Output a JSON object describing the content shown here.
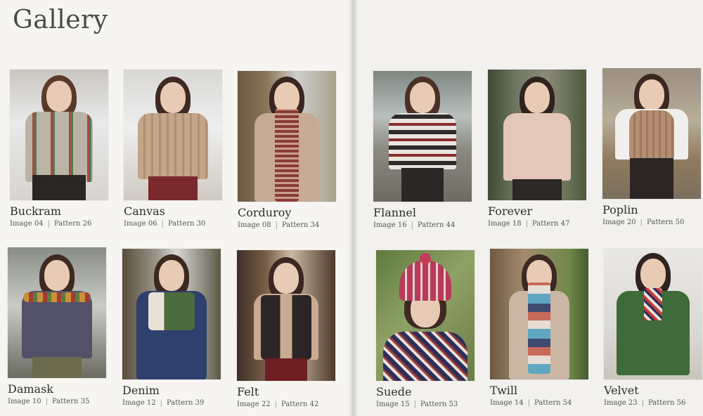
{
  "gallery": {
    "title": "Gallery",
    "items": [
      {
        "name": "Buckram",
        "image": "Image 04",
        "pattern": "Pattern 26"
      },
      {
        "name": "Canvas",
        "image": "Image 06",
        "pattern": "Pattern 30"
      },
      {
        "name": "Corduroy",
        "image": "Image 08",
        "pattern": "Pattern 34"
      },
      {
        "name": "Flannel",
        "image": "Image 16",
        "pattern": "Pattern 44"
      },
      {
        "name": "Forever",
        "image": "Image 18",
        "pattern": "Pattern 47"
      },
      {
        "name": "Poplin",
        "image": "Image 20",
        "pattern": "Pattern 50"
      },
      {
        "name": "Damask",
        "image": "Image 10",
        "pattern": "Pattern 35"
      },
      {
        "name": "Denim",
        "image": "Image 12",
        "pattern": "Pattern 39"
      },
      {
        "name": "Felt",
        "image": "Image 22",
        "pattern": "Pattern 42"
      },
      {
        "name": "Suede",
        "image": "Image 15",
        "pattern": "Pattern 53"
      },
      {
        "name": "Twill",
        "image": "Image 14",
        "pattern": "Pattern 54"
      },
      {
        "name": "Velvet",
        "image": "Image 23",
        "pattern": "Pattern 56"
      }
    ]
  },
  "colors": {
    "page": "#f6f5f2",
    "text": "#2e2e2e",
    "title": "#4a4a4a"
  }
}
